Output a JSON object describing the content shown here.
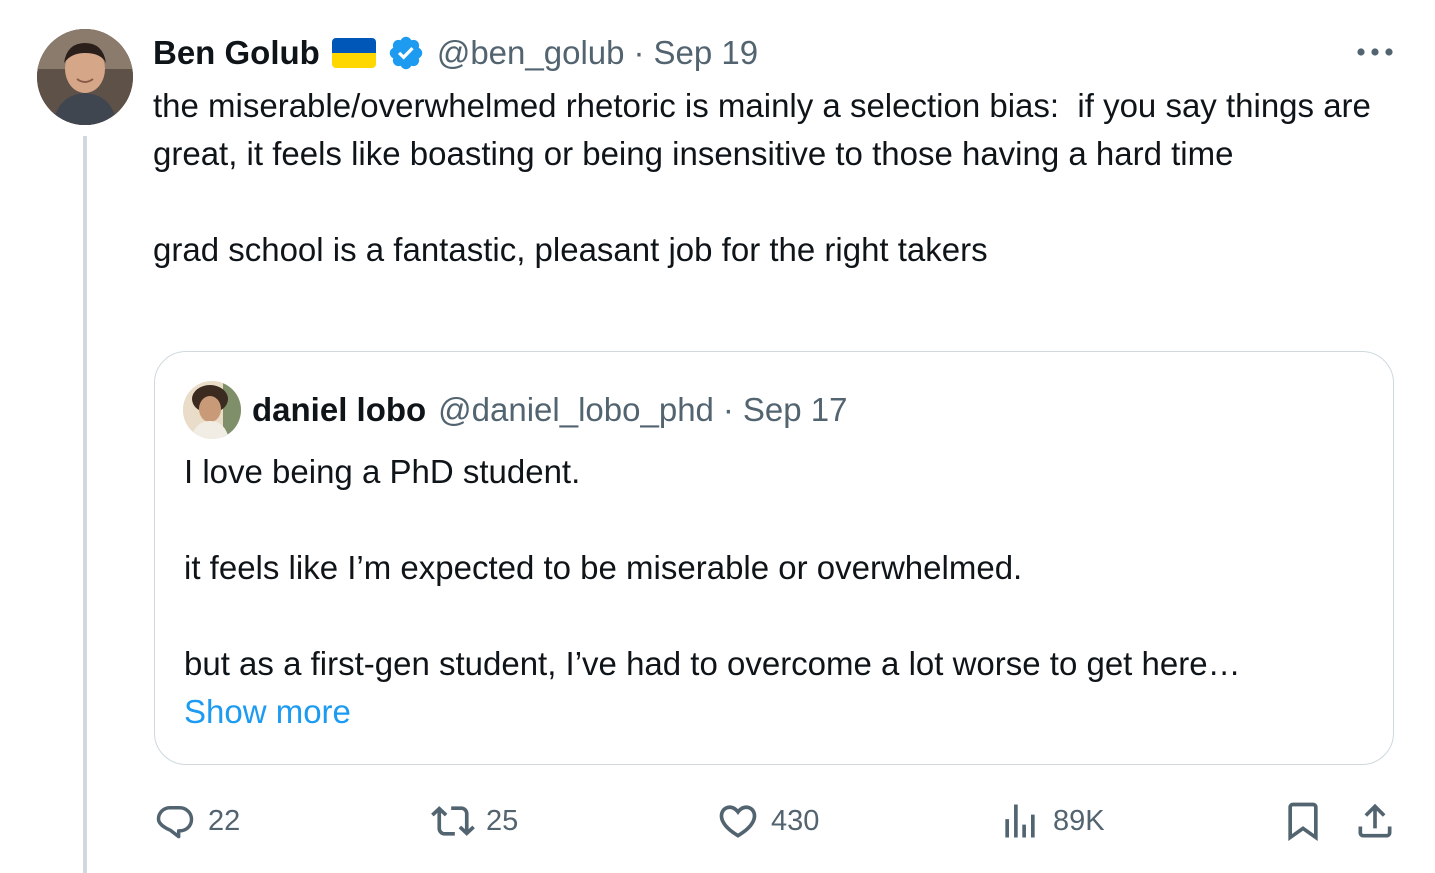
{
  "tweet": {
    "author": {
      "name": "Ben Golub",
      "flag_icon": "ukraine-flag-icon",
      "verified_icon": "verified-badge-icon",
      "handle": "@ben_golub",
      "separator": "·",
      "date": "Sep 19"
    },
    "more_icon": "more-options-icon",
    "text": "the miserable/overwhelmed rhetoric is mainly a selection bias:  if you say things are great, it feels like boasting or being insensitive to those having a hard time\n\ngrad school is a fantastic, pleasant job for the right takers"
  },
  "quote": {
    "author": {
      "name": "daniel lobo",
      "handle": "@daniel_lobo_phd",
      "separator": "·",
      "date": "Sep 17"
    },
    "text": "I love being a PhD student.\n\nit feels like I’m expected to be miserable or overwhelmed.\n\nbut as a first-gen student, I’ve had to overcome a lot worse to get here…",
    "show_more": "Show more"
  },
  "actions": {
    "reply": {
      "icon": "reply-icon",
      "count": "22"
    },
    "retweet": {
      "icon": "retweet-icon",
      "count": "25"
    },
    "like": {
      "icon": "heart-icon",
      "count": "430"
    },
    "views": {
      "icon": "views-icon",
      "count": "89K"
    },
    "bookmark": {
      "icon": "bookmark-icon"
    },
    "share": {
      "icon": "share-icon"
    }
  },
  "colors": {
    "text_primary": "#0f1419",
    "text_secondary": "#536471",
    "link": "#1d9bf0",
    "verified": "#1d9bf0",
    "border": "#cfd9de",
    "flag_blue": "#0057b7",
    "flag_yellow": "#ffd700"
  }
}
